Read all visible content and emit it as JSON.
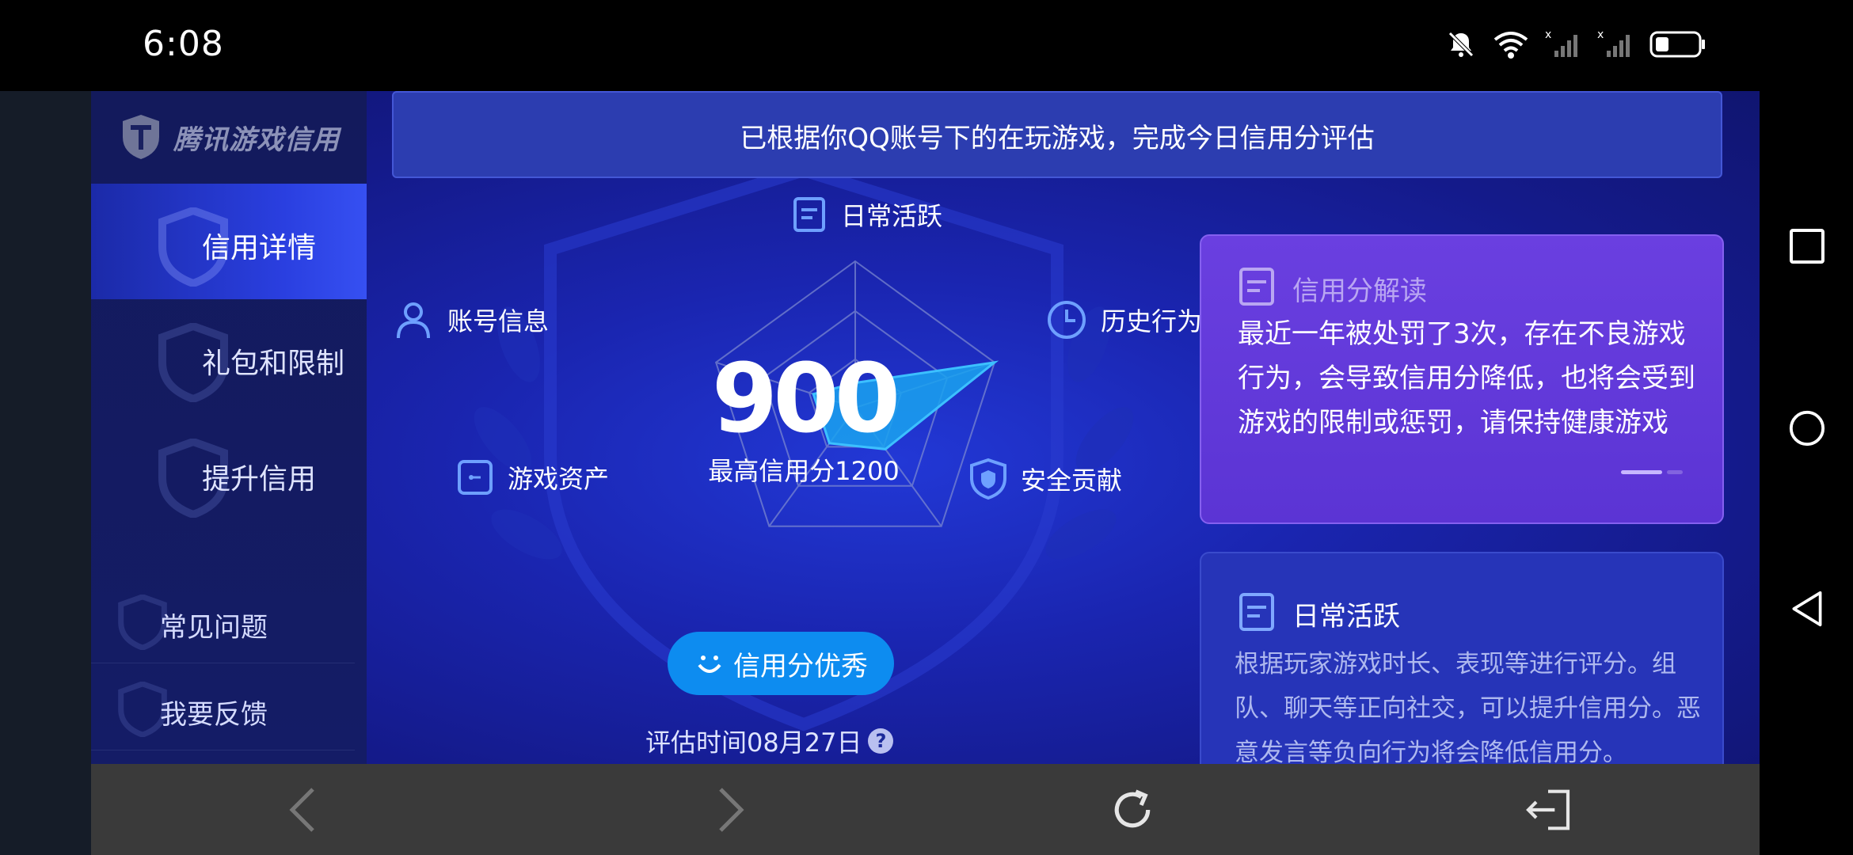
{
  "status_bar": {
    "time": "6:08"
  },
  "app": {
    "brand": "腾讯游戏信用",
    "sidebar": {
      "items": [
        {
          "label": "信用详情",
          "active": true
        },
        {
          "label": "礼包和限制",
          "active": false
        },
        {
          "label": "提升信用",
          "active": false
        }
      ],
      "links": [
        {
          "label": "常见问题"
        },
        {
          "label": "我要反馈"
        }
      ]
    },
    "banner": "已根据你QQ账号下的在玩游戏，完成今日信用分评估",
    "radar": {
      "dimensions": {
        "daily": "日常活跃",
        "history": "历史行为",
        "safety": "安全贡献",
        "assets": "游戏资产",
        "account": "账号信息"
      },
      "levels": {
        "daily": 0.17,
        "history": 1.0,
        "safety": 0.35,
        "assets": 0.3,
        "account": 0.3
      },
      "score": "900",
      "max_label": "最高信用分1200"
    },
    "rating_button": "信用分优秀",
    "eval_time": "评估时间08月27日",
    "help_icon": "?",
    "interpretation_card": {
      "title": "信用分解读",
      "body": "最近一年被处罚了3次，存在不良游戏行为，会导致信用分降低，也将会受到游戏的限制或惩罚，请保持健康游戏"
    },
    "daily_card": {
      "title": "日常活跃",
      "body": "根据玩家游戏时长、表现等进行评分。组队、聊天等正向社交，可以提升信用分。恶意发言等负向行为将会降低信用分。"
    }
  },
  "colors": {
    "accent_blue": "#0d8cf0",
    "radar_fill": "#1aa3f0",
    "card_purple": "#5b34d4",
    "card_blue": "#2634b8",
    "app_bg": "#1a25b0"
  }
}
